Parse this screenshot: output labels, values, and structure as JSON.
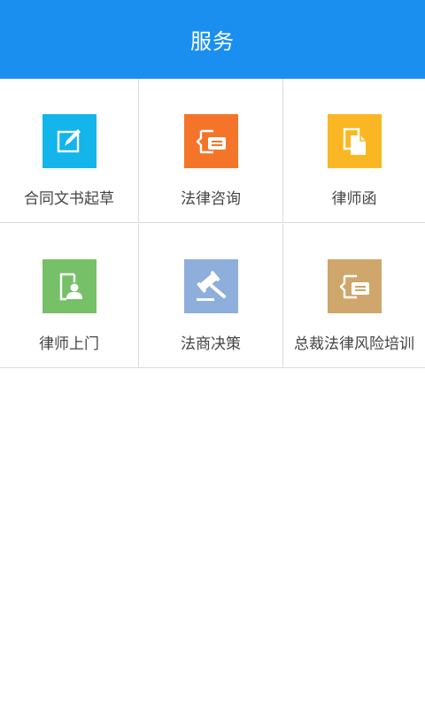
{
  "header": {
    "title": "服务"
  },
  "services": [
    {
      "label": "合同文书起草",
      "icon": "edit-document-icon",
      "color": "#13b5ea"
    },
    {
      "label": "法律咨询",
      "icon": "consult-chat-icon",
      "color": "#f47529"
    },
    {
      "label": "律师函",
      "icon": "letter-documents-icon",
      "color": "#fbb723"
    },
    {
      "label": "律师上门",
      "icon": "lawyer-person-icon",
      "color": "#76c067"
    },
    {
      "label": "法商决策",
      "icon": "gavel-icon",
      "color": "#8eaedc"
    },
    {
      "label": "总裁法律风险培训",
      "icon": "training-chat-icon",
      "color": "#cfa66b"
    }
  ]
}
